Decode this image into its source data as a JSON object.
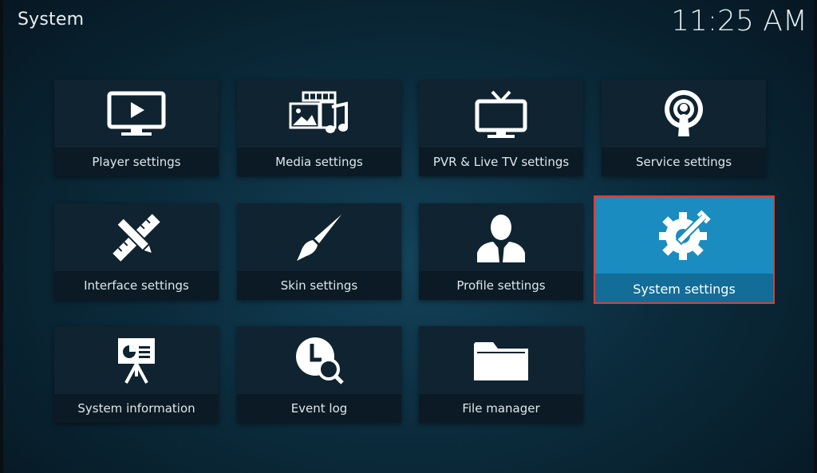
{
  "header": {
    "title": "System",
    "time": "11:25 AM"
  },
  "tiles": [
    {
      "label": "Player settings",
      "icon": "tv-play-icon"
    },
    {
      "label": "Media settings",
      "icon": "media-icon"
    },
    {
      "label": "PVR & Live TV settings",
      "icon": "tv-antenna-icon"
    },
    {
      "label": "Service settings",
      "icon": "podcast-icon"
    },
    {
      "label": "Interface settings",
      "icon": "pencil-ruler-icon"
    },
    {
      "label": "Skin settings",
      "icon": "paintbrush-icon"
    },
    {
      "label": "Profile settings",
      "icon": "user-icon"
    },
    {
      "label": "System settings",
      "icon": "gear-wrench-icon",
      "selected": true
    },
    {
      "label": "System information",
      "icon": "presentation-icon"
    },
    {
      "label": "Event log",
      "icon": "clock-search-icon"
    },
    {
      "label": "File manager",
      "icon": "folder-icon"
    }
  ],
  "colors": {
    "highlight": "#e53b2c",
    "selected_tile": "#1a8cc0"
  }
}
